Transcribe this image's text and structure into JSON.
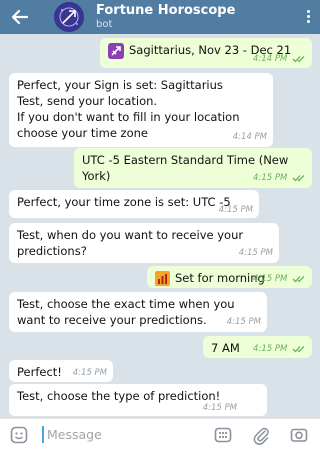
{
  "header": {
    "title": "Fortune Horoscope",
    "subtitle": "bot",
    "colors": {
      "bar": "#527da3"
    }
  },
  "messages": [
    {
      "dir": "out",
      "emoji": "sagittarius-sign",
      "text": "Sagittarius, Nov 23 - Dec 21",
      "time": "4:14 PM",
      "read": true
    },
    {
      "dir": "in",
      "lines": [
        "Perfect, your Sign is set: Sagittarius",
        "Test, send your location.",
        "If you don't want to fill in your location",
        "choose your time zone"
      ],
      "time": "4:14 PM"
    },
    {
      "dir": "out",
      "lines": [
        "UTC -5 Eastern Standard Time (New",
        "York)"
      ],
      "time": "4:15 PM",
      "read": true
    },
    {
      "dir": "in",
      "text": "Perfect, your time zone is set: UTC -5",
      "time": "4:15 PM"
    },
    {
      "dir": "in",
      "lines": [
        "Test, when do you want to receive your",
        "predictions?"
      ],
      "time": "4:15 PM"
    },
    {
      "dir": "out",
      "emoji": "bar-chart",
      "text": "Set for morning",
      "time": "4:15 PM",
      "read": true
    },
    {
      "dir": "in",
      "lines": [
        "Test, choose the exact time when you",
        "want to receive your predictions."
      ],
      "time": "4:15 PM"
    },
    {
      "dir": "out",
      "text": "7 AM",
      "time": "4:15 PM",
      "read": true
    },
    {
      "dir": "in",
      "text": "Perfect!",
      "time": "4:15 PM"
    },
    {
      "dir": "in",
      "text": "Test, choose the type of prediction!",
      "time": "4:15 PM"
    }
  ],
  "input": {
    "placeholder": "Message"
  },
  "colors": {
    "chat_bg": "#d9e2e8",
    "incoming": "#ffffff",
    "outgoing": "#eefed6",
    "timestamp_out": "#6ab15c"
  }
}
